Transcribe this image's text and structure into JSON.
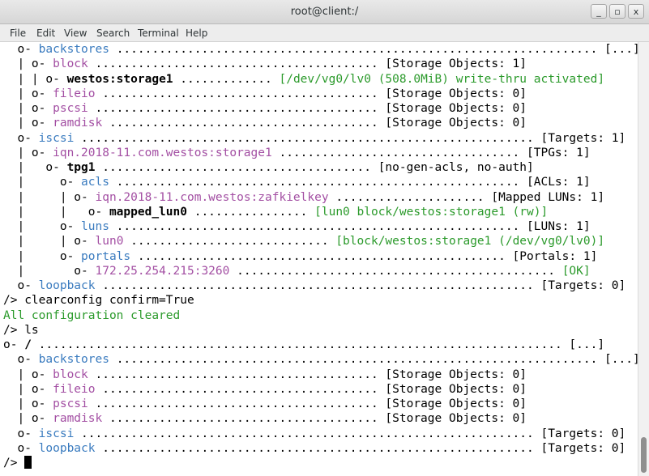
{
  "window": {
    "title": "root@client:/",
    "buttons": [
      "_",
      "▫",
      "x"
    ]
  },
  "menu": [
    "File",
    "Edit",
    "View",
    "Search",
    "Terminal",
    "Help"
  ],
  "terminal": {
    "lines": [
      [
        [
          "  o- ",
          ""
        ],
        [
          "backstores",
          "b"
        ],
        [
          " .................................................................... [...]",
          ""
        ]
      ],
      [
        [
          "  | o- ",
          ""
        ],
        [
          "block",
          "p"
        ],
        [
          " ........................................ [Storage Objects: 1]",
          ""
        ]
      ],
      [
        [
          "  | | o- ",
          ""
        ],
        [
          "westos:storage1",
          "k"
        ],
        [
          " ............. ",
          ""
        ],
        [
          "[/dev/vg0/lv0 (508.0MiB) write-thru activated]",
          "g"
        ]
      ],
      [
        [
          "  | o- ",
          ""
        ],
        [
          "fileio",
          "p"
        ],
        [
          " ....................................... [Storage Objects: 0]",
          ""
        ]
      ],
      [
        [
          "  | o- ",
          ""
        ],
        [
          "pscsi",
          "p"
        ],
        [
          " ........................................ [Storage Objects: 0]",
          ""
        ]
      ],
      [
        [
          "  | o- ",
          ""
        ],
        [
          "ramdisk",
          "p"
        ],
        [
          " ...................................... [Storage Objects: 0]",
          ""
        ]
      ],
      [
        [
          "  o- ",
          ""
        ],
        [
          "iscsi",
          "b"
        ],
        [
          " ................................................................ [Targets: 1]",
          ""
        ]
      ],
      [
        [
          "  | o- ",
          ""
        ],
        [
          "iqn.2018-11.com.westos:storage1",
          "p"
        ],
        [
          " .................................. [TPGs: 1]",
          ""
        ]
      ],
      [
        [
          "  |   o- ",
          ""
        ],
        [
          "tpg1",
          "k"
        ],
        [
          " ...................................... [no-gen-acls, no-auth]",
          ""
        ]
      ],
      [
        [
          "  |     o- ",
          ""
        ],
        [
          "acls",
          "b"
        ],
        [
          " ......................................................... [ACLs: 1]",
          ""
        ]
      ],
      [
        [
          "  |     | o- ",
          ""
        ],
        [
          "iqn.2018-11.com.westos:zafkielkey",
          "p"
        ],
        [
          " ..................... [Mapped LUNs: 1]",
          ""
        ]
      ],
      [
        [
          "  |     |   o- ",
          ""
        ],
        [
          "mapped_lun0",
          "k"
        ],
        [
          " ................ ",
          ""
        ],
        [
          "[lun0 block/westos:storage1 (rw)]",
          "g"
        ]
      ],
      [
        [
          "  |     o- ",
          ""
        ],
        [
          "luns",
          "b"
        ],
        [
          " ......................................................... [LUNs: 1]",
          ""
        ]
      ],
      [
        [
          "  |     | o- ",
          ""
        ],
        [
          "lun0",
          "p"
        ],
        [
          " ............................ ",
          ""
        ],
        [
          "[block/westos:storage1 (/dev/vg0/lv0)]",
          "g"
        ]
      ],
      [
        [
          "  |     o- ",
          ""
        ],
        [
          "portals",
          "b"
        ],
        [
          " .................................................... [Portals: 1]",
          ""
        ]
      ],
      [
        [
          "  |       o- ",
          ""
        ],
        [
          "172.25.254.215:3260",
          "p"
        ],
        [
          " ............................................. ",
          ""
        ],
        [
          "[OK]",
          "g"
        ]
      ],
      [
        [
          "  o- ",
          ""
        ],
        [
          "loopback",
          "b"
        ],
        [
          " ............................................................. [Targets: 0]",
          ""
        ]
      ],
      [
        [
          "/> clearconfig confirm=True",
          ""
        ]
      ],
      [
        [
          "All configuration cleared",
          "g"
        ]
      ],
      [
        [
          "/> ls",
          ""
        ]
      ],
      [
        [
          "o- ",
          ""
        ],
        [
          "/",
          "k"
        ],
        [
          " .......................................................................... [...]",
          ""
        ]
      ],
      [
        [
          "  o- ",
          ""
        ],
        [
          "backstores",
          "b"
        ],
        [
          " .................................................................... [...]",
          ""
        ]
      ],
      [
        [
          "  | o- ",
          ""
        ],
        [
          "block",
          "p"
        ],
        [
          " ........................................ [Storage Objects: 0]",
          ""
        ]
      ],
      [
        [
          "  | o- ",
          ""
        ],
        [
          "fileio",
          "p"
        ],
        [
          " ....................................... [Storage Objects: 0]",
          ""
        ]
      ],
      [
        [
          "  | o- ",
          ""
        ],
        [
          "pscsi",
          "p"
        ],
        [
          " ........................................ [Storage Objects: 0]",
          ""
        ]
      ],
      [
        [
          "  | o- ",
          ""
        ],
        [
          "ramdisk",
          "p"
        ],
        [
          " ...................................... [Storage Objects: 0]",
          ""
        ]
      ],
      [
        [
          "  o- ",
          ""
        ],
        [
          "iscsi",
          "b"
        ],
        [
          " ................................................................ [Targets: 0]",
          ""
        ]
      ],
      [
        [
          "  o- ",
          ""
        ],
        [
          "loopback",
          "b"
        ],
        [
          " ............................................................. [Targets: 0]",
          ""
        ]
      ]
    ],
    "prompt": "/> "
  },
  "colors": {
    "link_blue": "#3a7bbf",
    "purple": "#a34fa3",
    "green": "#2b9a2b"
  }
}
